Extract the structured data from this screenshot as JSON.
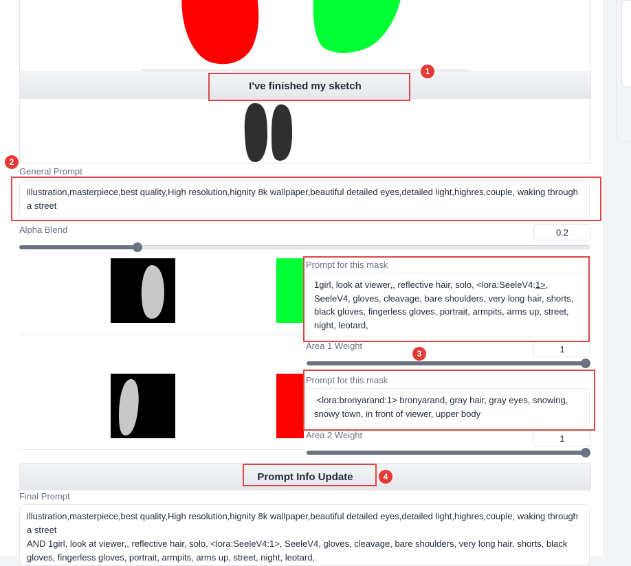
{
  "sketch": {
    "finish_button": "I've finished my sketch",
    "stroke_colors": [
      "#ff0000",
      "#00ff33"
    ]
  },
  "general_prompt": {
    "label": "General Prompt",
    "value": "illustration,masterpiece,best quality,High resolution,hignity 8k wallpaper,beautiful detailed eyes,detailed light,highres,couple, waking through a street"
  },
  "alpha_blend": {
    "label": "Alpha Blend",
    "value": "0.2",
    "fraction": 0.2
  },
  "masks": [
    {
      "swatch_color": "#00ff33",
      "prompt_label": "Prompt for this mask",
      "prompt_pre": "1girl, look at viewer",
      "prompt_underlined_1": ",,",
      "prompt_mid": " reflective hair, solo, <lora:SeeleV4:",
      "prompt_underlined_2": "1>,",
      "prompt_post": " SeeleV4, gloves, cleavage, bare shoulders, very long hair, shorts, black gloves, fingerless gloves, portrait, armpits, arms up, street, night, leotard,",
      "weight_label": "Area 1 Weight",
      "weight_value": "1",
      "weight_fraction": 1.0
    },
    {
      "swatch_color": "#ff0000",
      "prompt_label": "Prompt for this mask",
      "prompt": " <lora:bronyarand:1> bronyarand, gray hair, gray eyes, snowing, snowy town, in front of viewer, upper body",
      "weight_label": "Area 2 Weight",
      "weight_value": "1",
      "weight_fraction": 1.0
    }
  ],
  "update_button": "Prompt Info Update",
  "final_prompt": {
    "label": "Final Prompt",
    "line1": "illustration,masterpiece,best quality,High resolution,hignity 8k wallpaper,beautiful detailed eyes,detailed light,highres,couple, waking through a street",
    "line2": "AND 1girl, look at viewer,, reflective hair, solo, <lora:SeeleV4:1>, SeeleV4, gloves, cleavage, bare shoulders, very long hair, shorts, black gloves, fingerless gloves, portrait, armpits, arms up, street, night, leotard,"
  },
  "annotations": [
    "1",
    "2",
    "3",
    "4"
  ],
  "annotation_color": "#e53935"
}
